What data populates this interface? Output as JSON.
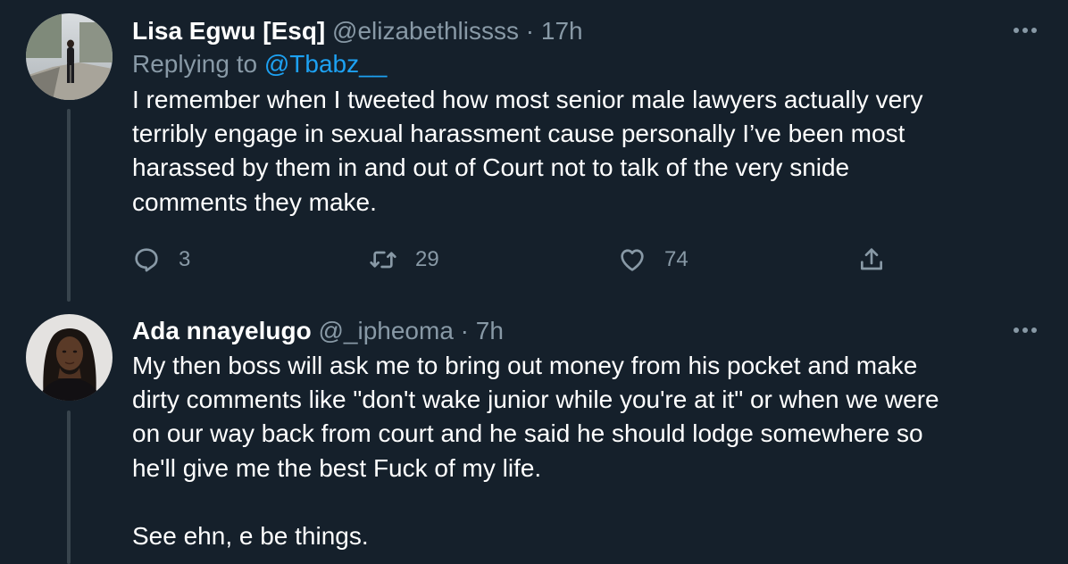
{
  "tweets": [
    {
      "display_name": "Lisa Egwu [Esq]",
      "handle": "@elizabethlissss",
      "separator": "·",
      "time": "17h",
      "replying_prefix": "Replying to",
      "replying_to": "@Tbabz__",
      "text": "I remember when I tweeted how most senior male lawyers actually very\nterribly engage in sexual harassment cause personally I’ve been most\nharassed by them in and out of Court not to talk of the very snide\ncomments they make.",
      "reply_count": "3",
      "retweet_count": "29",
      "like_count": "74"
    },
    {
      "display_name": "Ada nnayelugo",
      "handle": "@_ipheoma",
      "separator": "·",
      "time": "7h",
      "text": "My then boss will ask me to bring out money from his pocket and make\ndirty comments like \"don't wake junior while you're at it\" or when we were\non our way back from court and he said he should lodge somewhere so\nhe'll give me the best Fuck of my life.\n\nSee ehn, e be things."
    }
  ],
  "icons": {
    "more": "more-horizontal-icon",
    "reply": "reply-icon",
    "retweet": "retweet-icon",
    "like": "heart-icon",
    "share": "share-icon"
  },
  "colors": {
    "background": "#15202b",
    "primary_text": "#ffffff",
    "secondary_text": "#8899a6",
    "link": "#1da1f2",
    "thread_line": "#38444d"
  }
}
